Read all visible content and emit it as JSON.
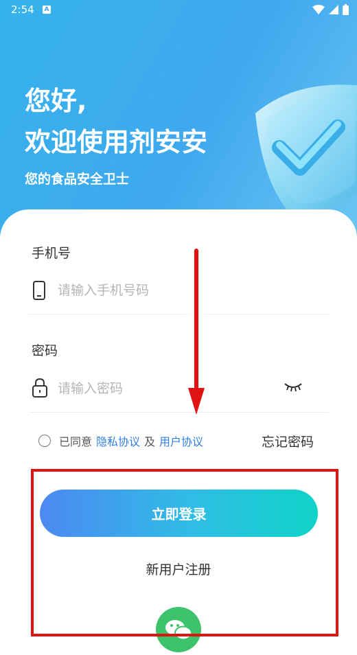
{
  "status_bar": {
    "time": "2:54",
    "indicator": "A",
    "icons": [
      "wifi-icon",
      "signal-icon",
      "battery-icon"
    ]
  },
  "header": {
    "greeting_line1": "您好,",
    "greeting_line2": "欢迎使用剂安安",
    "subtitle": "您的食品安全卫士"
  },
  "form": {
    "phone": {
      "label": "手机号",
      "placeholder": "请输入手机号码",
      "value": "",
      "icon": "phone-icon"
    },
    "password": {
      "label": "密码",
      "placeholder": "请输入密码",
      "value": "",
      "icon": "lock-icon",
      "toggle_icon": "eye-closed-icon"
    },
    "agreement": {
      "prefix": "已同意",
      "privacy_link": "隐私协议",
      "conjunction": "及",
      "user_link": "用户协议",
      "checked": false
    },
    "forgot_password": "忘记密码"
  },
  "actions": {
    "login_label": "立即登录",
    "register_label": "新用户注册",
    "wechat_icon": "wechat-icon"
  },
  "colors": {
    "hero": "#3fa8ee",
    "login_gradient_start": "#4c89f2",
    "login_gradient_end": "#0fd3c7",
    "link": "#2f7fe0",
    "annotation": "#e01212",
    "wechat": "#3cc36b"
  },
  "annotations": [
    "red-arrow",
    "red-highlight-box"
  ]
}
